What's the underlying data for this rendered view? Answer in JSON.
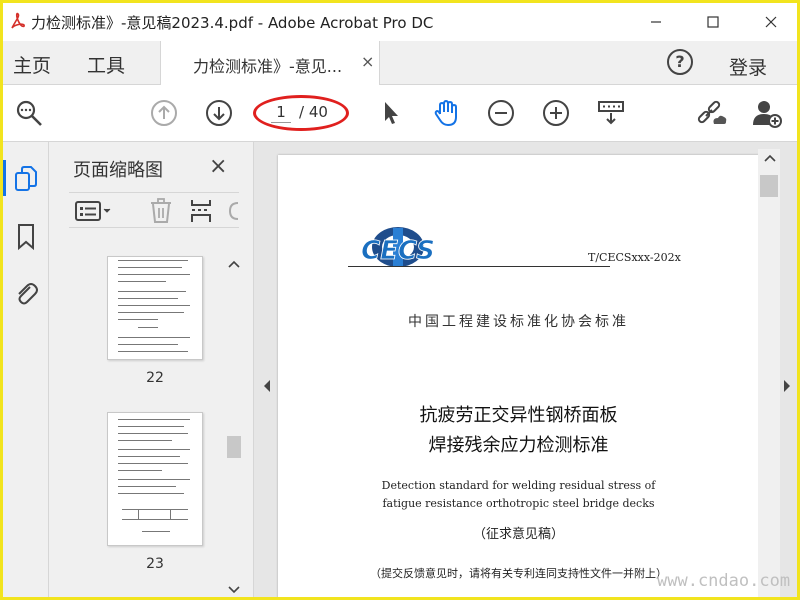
{
  "window": {
    "title": "力检测标准》-意见稿2023.4.pdf - Adobe Acrobat Pro DC"
  },
  "tabs": {
    "home": "主页",
    "tools": "工具",
    "document": "力检测标准》-意见...",
    "close": "×"
  },
  "header": {
    "help": "?",
    "login": "登录"
  },
  "toolbar": {
    "current_page": "1",
    "total_pages": "/ 40",
    "icons": [
      "zoom-search-icon",
      "prev-page-icon",
      "next-page-icon",
      "select-cursor-icon",
      "hand-tool-icon",
      "zoom-out-icon",
      "zoom-in-icon",
      "scroll-mode-icon",
      "share-link-icon",
      "add-user-icon"
    ]
  },
  "thumbnails_panel": {
    "title": "页面缩略图",
    "close": "×",
    "pages": [
      {
        "label": "22"
      },
      {
        "label": "23"
      }
    ]
  },
  "document": {
    "logo_text": "CECS",
    "standard_number": "T/CECSxxx-202x",
    "organization": "中国工程建设标准化协会标准",
    "title_line1": "抗疲劳正交异性钢桥面板",
    "title_line2": "焊接残余应力检测标准",
    "english_line1": "Detection standard for welding residual stress of",
    "english_line2": "fatigue resistance orthotropic steel bridge decks",
    "draft_label": "（征求意见稿）",
    "note": "（提交反馈意见时，请将有关专利连同支持性文件一并附上）"
  },
  "watermark": "www.cndao.com",
  "colors": {
    "frame": "#f2e41e",
    "accent": "#1473e6",
    "annotation": "#e0201e",
    "logo_blue": "#1a6fc0"
  }
}
